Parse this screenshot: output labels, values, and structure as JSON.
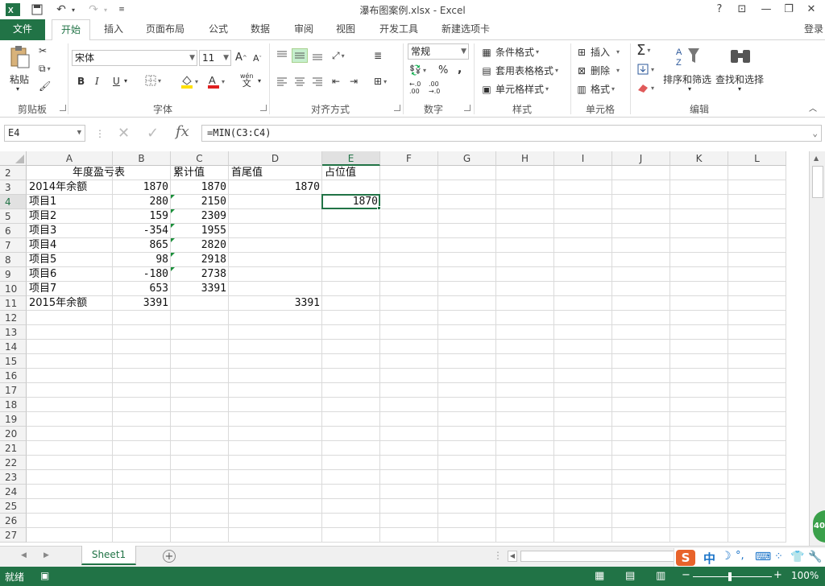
{
  "window": {
    "title": "瀑布图案例.xlsx - Excel",
    "help": "?",
    "login": "登录"
  },
  "ribbon_tabs": [
    "开始",
    "插入",
    "页面布局",
    "公式",
    "数据",
    "审阅",
    "视图",
    "开发工具",
    "新建选项卡"
  ],
  "file_tab": "文件",
  "ribbon": {
    "clipboard": {
      "label": "剪贴板",
      "paste": "粘贴"
    },
    "font": {
      "label": "字体",
      "name": "宋体",
      "size": "11",
      "bold": "B",
      "italic": "I",
      "underline": "U",
      "wen": "wén",
      "wen_char": "文"
    },
    "alignment": {
      "label": "对齐方式"
    },
    "number": {
      "label": "数字",
      "format": "常规",
      "percent": "%",
      "comma": ","
    },
    "styles": {
      "label": "样式",
      "conditional": "条件格式",
      "table": "套用表格格式",
      "cell": "单元格样式"
    },
    "cells": {
      "label": "单元格",
      "insert": "插入",
      "delete": "删除",
      "format": "格式"
    },
    "editing": {
      "label": "编辑",
      "sort": "排序和筛选",
      "find": "查找和选择",
      "sigma": "Σ"
    }
  },
  "formula_bar": {
    "name_box": "E4",
    "formula": "=MIN(C3:C4)"
  },
  "columns": [
    "A",
    "B",
    "C",
    "D",
    "E",
    "F",
    "G",
    "H",
    "I",
    "J",
    "K",
    "L"
  ],
  "rows": [
    "2",
    "3",
    "4",
    "5",
    "6",
    "7",
    "8",
    "9",
    "10",
    "11",
    "12",
    "13",
    "14",
    "15",
    "16",
    "17",
    "18",
    "19",
    "20",
    "21",
    "22",
    "23",
    "24",
    "25",
    "26",
    "27"
  ],
  "selected": {
    "column": "E",
    "row": "4"
  },
  "table": {
    "title": "年度盈亏表",
    "headers": {
      "c": "累计值",
      "d": "首尾值",
      "e": "占位值"
    },
    "data": [
      {
        "a": "2014年余额",
        "b": "1870",
        "c": "1870",
        "d": "1870",
        "e": ""
      },
      {
        "a": "项目1",
        "b": "280",
        "c": "2150",
        "d": "",
        "e": "1870"
      },
      {
        "a": "项目2",
        "b": "159",
        "c": "2309",
        "d": "",
        "e": ""
      },
      {
        "a": "项目3",
        "b": "-354",
        "c": "1955",
        "d": "",
        "e": ""
      },
      {
        "a": "项目4",
        "b": "865",
        "c": "2820",
        "d": "",
        "e": ""
      },
      {
        "a": "项目5",
        "b": "98",
        "c": "2918",
        "d": "",
        "e": ""
      },
      {
        "a": "项目6",
        "b": "-180",
        "c": "2738",
        "d": "",
        "e": ""
      },
      {
        "a": "项目7",
        "b": "653",
        "c": "3391",
        "d": "",
        "e": ""
      },
      {
        "a": "2015年余额",
        "b": "3391",
        "c": "",
        "d": "3391",
        "e": ""
      }
    ]
  },
  "sheets": [
    "Sheet1"
  ],
  "status": {
    "ready": "就绪",
    "zoom": "100%"
  },
  "ime": {
    "logo": "S",
    "mode": "中",
    "moon": "☽",
    "dots": "°,"
  },
  "colors": {
    "accent": "#217346"
  }
}
